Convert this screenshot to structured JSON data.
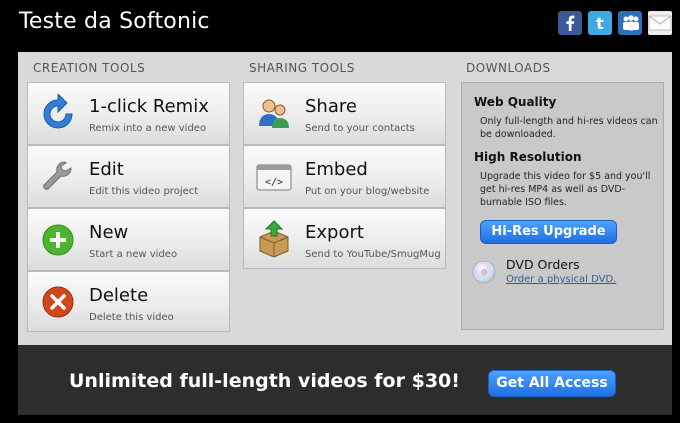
{
  "header": {
    "title": "Teste da Softonic",
    "social": [
      "facebook-icon",
      "twitter-icon",
      "myspace-icon",
      "email-icon"
    ]
  },
  "columns": {
    "creation": "CREATION TOOLS",
    "sharing": "SHARING TOOLS",
    "downloads": "DOWNLOADS"
  },
  "creation_tools": [
    {
      "label": "1-click Remix",
      "sub": "Remix into a new video",
      "icon": "remix-arrow-icon"
    },
    {
      "label": "Edit",
      "sub": "Edit this video project",
      "icon": "wrench-icon"
    },
    {
      "label": "New",
      "sub": "Start a new video",
      "icon": "plus-circle-icon"
    },
    {
      "label": "Delete",
      "sub": "Delete this video",
      "icon": "delete-x-icon"
    }
  ],
  "sharing_tools": [
    {
      "label": "Share",
      "sub": "Send to your contacts",
      "icon": "users-icon"
    },
    {
      "label": "Embed",
      "sub": "Put on your blog/website",
      "icon": "code-window-icon"
    },
    {
      "label": "Export",
      "sub": "Send to YouTube/SmugMug",
      "icon": "export-box-icon"
    }
  ],
  "downloads": {
    "web_quality_title": "Web Quality",
    "web_quality_text": "Only full-length and hi-res videos can be downloaded.",
    "high_res_title": "High Resolution",
    "high_res_text": "Upgrade this video for $5 and you'll get hi-res MP4 as well as DVD-burnable ISO files.",
    "upgrade_button": "Hi-Res Upgrade",
    "dvd_title": "DVD Orders",
    "dvd_link": "Order a physical DVD."
  },
  "footer": {
    "promo": "Unlimited full-length videos for $30!",
    "button": "Get All Access"
  },
  "colors": {
    "accent_blue": "#2f86f0",
    "panel": "#d9d9d9",
    "footer": "#2d2d2d"
  }
}
